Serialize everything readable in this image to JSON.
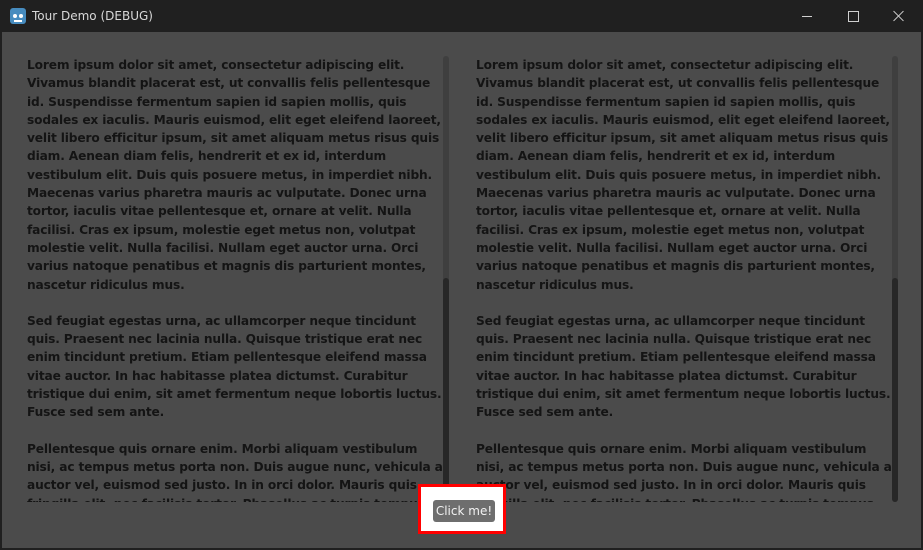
{
  "window": {
    "title": "Tour Demo (DEBUG)",
    "icon": "godot-engine-icon"
  },
  "panels": [
    {
      "paragraphs": [
        "Lorem ipsum dolor sit amet, consectetur adipiscing elit. Vivamus blandit placerat est, ut convallis felis pellentesque id. Suspendisse fermentum sapien id sapien mollis, quis sodales ex iaculis. Mauris euismod, elit eget eleifend laoreet, velit libero efficitur ipsum, sit amet aliquam metus risus quis diam. Aenean diam felis, hendrerit et ex id, interdum vestibulum elit. Duis quis posuere metus, in imperdiet nibh. Maecenas varius pharetra mauris ac vulputate. Donec urna tortor, iaculis vitae pellentesque et, ornare at velit. Nulla facilisi. Cras ex ipsum, molestie eget metus non, volutpat molestie velit. Nulla facilisi. Nullam eget auctor urna. Orci varius natoque penatibus et magnis dis parturient montes, nascetur ridiculus mus.",
        "Sed feugiat egestas urna, ac ullamcorper neque tincidunt quis. Praesent nec lacinia nulla. Quisque tristique erat nec enim tincidunt pretium. Etiam pellentesque eleifend massa vitae auctor. In hac habitasse platea dictumst. Curabitur tristique dui enim, sit amet fermentum neque lobortis luctus. Fusce sed sem ante.",
        "Pellentesque quis ornare enim. Morbi aliquam vestibulum nisi, ac tempus metus porta non. Duis augue nunc, vehicula a auctor vel, euismod sed justo. In in orci dolor. Mauris quis fringilla elit, nec facilisis tortor. Phasellus ac turpis tempus, vestibulum arcu ac,"
      ]
    },
    {
      "paragraphs": [
        "Lorem ipsum dolor sit amet, consectetur adipiscing elit. Vivamus blandit placerat est, ut convallis felis pellentesque id. Suspendisse fermentum sapien id sapien mollis, quis sodales ex iaculis. Mauris euismod, elit eget eleifend laoreet, velit libero efficitur ipsum, sit amet aliquam metus risus quis diam. Aenean diam felis, hendrerit et ex id, interdum vestibulum elit. Duis quis posuere metus, in imperdiet nibh. Maecenas varius pharetra mauris ac vulputate. Donec urna tortor, iaculis vitae pellentesque et, ornare at velit. Nulla facilisi. Cras ex ipsum, molestie eget metus non, volutpat molestie velit. Nulla facilisi. Nullam eget auctor urna. Orci varius natoque penatibus et magnis dis parturient montes, nascetur ridiculus mus.",
        "Sed feugiat egestas urna, ac ullamcorper neque tincidunt quis. Praesent nec lacinia nulla. Quisque tristique erat nec enim tincidunt pretium. Etiam pellentesque eleifend massa vitae auctor. In hac habitasse platea dictumst. Curabitur tristique dui enim, sit amet fermentum neque lobortis luctus. Fusce sed sem ante.",
        "Pellentesque quis ornare enim. Morbi aliquam vestibulum nisi, ac tempus metus porta non. Duis augue nunc, vehicula a auctor vel, euismod sed justo. In in orci dolor. Mauris quis fringilla elit, nec facilisis tortor. Phasellus ac turpis tempus, vestibulum arcu ac,"
      ]
    }
  ],
  "button": {
    "label": "Click me!",
    "highlight_color": "#ff0000"
  },
  "colors": {
    "client_background": "#4b4b4b",
    "titlebar_background": "#202020",
    "text": "#141414"
  }
}
